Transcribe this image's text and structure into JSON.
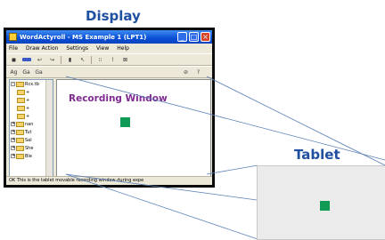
{
  "display": {
    "heading": "Display"
  },
  "tablet": {
    "heading": "Tablet"
  },
  "app": {
    "title": "WordActyroll - MS Example 1 (LPT1)",
    "window_buttons": [
      "_",
      "□",
      "×"
    ],
    "menu": [
      "File",
      "Draw Action",
      "Settings",
      "View",
      "Help"
    ],
    "toolbar1": [
      "◼",
      "◼",
      "↩",
      "↪",
      "▮",
      "↖",
      "⁝⁝",
      "!",
      "⊠"
    ],
    "toolbar2": [
      "Ag",
      "Ga",
      "Ga",
      "⊘",
      "?"
    ],
    "tree_rows": [
      "Rcx.tb",
      "+",
      "+",
      "+",
      "+",
      "nan",
      "Tut",
      "Sal",
      "She",
      "Ble"
    ],
    "recording_label": "Recording Window",
    "status": "OK  This is the tablet movable recording window during expe"
  },
  "colors": {
    "heading": "#1f4fa0",
    "recording_label": "#7e2a8f",
    "marker": "#0f9a55",
    "tablet_bg": "#ebebeb",
    "link_lines": "#5b7fb8"
  }
}
